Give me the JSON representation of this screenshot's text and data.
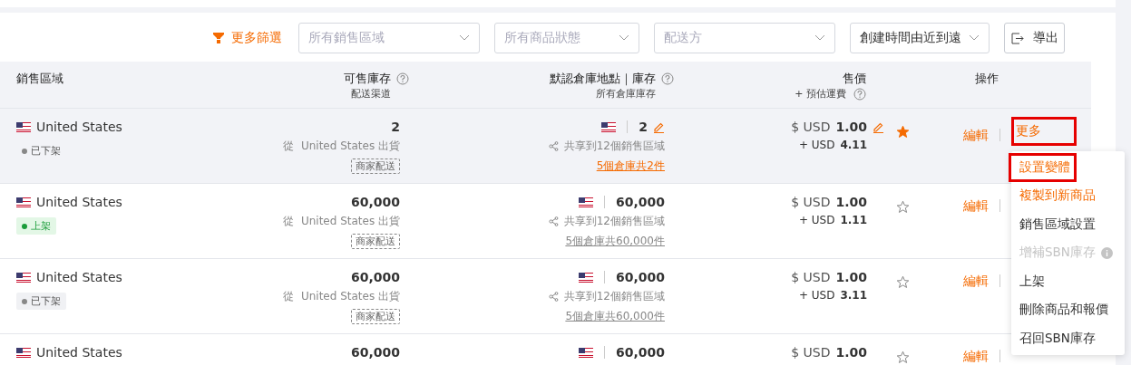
{
  "filters": {
    "more_filters": "更多篩選",
    "selects": [
      {
        "placeholder": "所有銷售區域"
      },
      {
        "placeholder": "所有商品狀態"
      },
      {
        "placeholder": "配送方"
      },
      {
        "value": "創建時間由近到遠"
      }
    ],
    "export": "導出"
  },
  "table": {
    "columns": [
      {
        "label": "銷售區域"
      },
      {
        "label": "可售庫存",
        "sub": "配送渠道",
        "help": true
      },
      {
        "label": "默認倉庫地點｜庫存",
        "sub": "所有倉庫庫存",
        "help": true
      },
      {
        "label": "售價",
        "sub": "+ 預估運費",
        "help": true
      },
      {
        "label": "操作"
      }
    ],
    "rows": [
      {
        "hovered": true,
        "region": "United States",
        "status": "已下架",
        "listed": false,
        "stock": "2",
        "ship_from": "從  United States 出貨",
        "channel": "商家配送",
        "warehouse_qty": "2",
        "shared": "共享到12個銷售區域",
        "warehouses": "5個倉庫共2件",
        "currency": "$ USD",
        "price": "1.00",
        "ship_currency": "+ USD",
        "shipping": "4.11",
        "starred": true,
        "edit": "編輯",
        "more": "更多",
        "more_highlighted": true
      },
      {
        "hovered": false,
        "region": "United States",
        "status": "上架",
        "listed": true,
        "stock": "60,000",
        "ship_from": "從  United States 出貨",
        "channel": "商家配送",
        "warehouse_qty": "60,000",
        "shared": "共享到12個銷售區域",
        "warehouses": "5個倉庫共60,000件",
        "currency": "$ USD",
        "price": "1.00",
        "ship_currency": "+ USD",
        "shipping": "1.11",
        "starred": false,
        "edit": "編輯"
      },
      {
        "hovered": false,
        "region": "United States",
        "status": "已下架",
        "listed": false,
        "stock": "60,000",
        "ship_from": "從  United States 出貨",
        "channel": "商家配送",
        "warehouse_qty": "60,000",
        "shared": "共享到12個銷售區域",
        "warehouses": "5個倉庫共60,000件",
        "currency": "$ USD",
        "price": "1.00",
        "ship_currency": "+ USD",
        "shipping": "3.11",
        "starred": false,
        "edit": "編輯"
      },
      {
        "hovered": false,
        "region": "United States",
        "stock": "60,000",
        "warehouse_qty": "60,000",
        "currency": "$ USD",
        "price": "1.00",
        "starred": false,
        "edit": "編輯"
      }
    ]
  },
  "menu": {
    "items": [
      {
        "label": "設置變體",
        "accent": true,
        "highlighted": true,
        "disabled": false
      },
      {
        "label": "複製到新商品",
        "accent": true,
        "highlighted": false,
        "disabled": false
      },
      {
        "label": "銷售區域設置",
        "accent": false,
        "highlighted": false,
        "disabled": false
      },
      {
        "label": "增補SBN庫存",
        "accent": false,
        "highlighted": false,
        "disabled": true,
        "info": true
      },
      {
        "label": "上架",
        "accent": false,
        "highlighted": false,
        "disabled": false
      },
      {
        "label": "刪除商品和報價",
        "accent": false,
        "highlighted": false,
        "disabled": false
      },
      {
        "label": "召回SBN庫存",
        "accent": false,
        "highlighted": false,
        "disabled": false
      }
    ]
  }
}
